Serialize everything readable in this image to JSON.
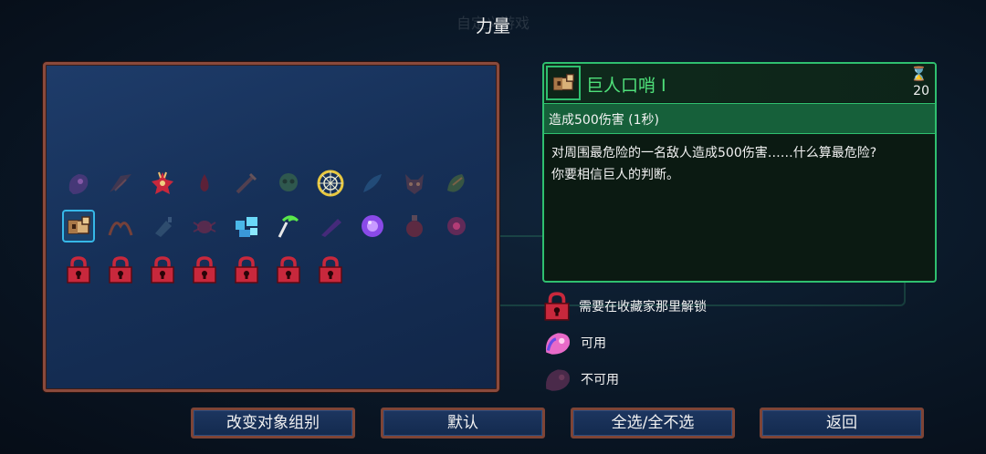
{
  "title": "力量",
  "icons_row1": [
    "pink-blob-disabled-icon",
    "dark-wings-icon",
    "red-tentacle-creature-icon",
    "blood-drop-icon",
    "syringe-icon",
    "green-skull-icon",
    "golden-web-medallion-icon",
    "blue-feather-icon",
    "demon-mask-icon",
    "green-lizard-icon"
  ],
  "icons_row2": [
    "giant-whistle-icon",
    "fire-wave-icon",
    "ice-bottle-icon",
    "red-spider-icon",
    "blue-crystal-cluster-icon",
    "green-scythe-icon",
    "purple-dagger-icon",
    "purple-orb-icon",
    "red-potion-icon",
    "pink-eye-icon"
  ],
  "locked_count": 7,
  "colors": {
    "lock": "#c8283c",
    "selected_border": "#36b8e8",
    "detail_accent": "#2fbf6f",
    "item_name": "#4fe07a"
  },
  "detail": {
    "name": "巨人口哨 I",
    "cooldown": "20",
    "effect": "造成500伤害 (1秒)",
    "desc_line1": "对周围最危险的一名敌人造成500伤害……什么算最危险?",
    "desc_line2": "你要相信巨人的判断。"
  },
  "legend": {
    "locked": "需要在收藏家那里解锁",
    "available": "可用",
    "unavailable": "不可用"
  },
  "buttons": {
    "change_group": "改变对象组别",
    "default": "默认",
    "select_all": "全选/全不选",
    "back": "返回"
  }
}
